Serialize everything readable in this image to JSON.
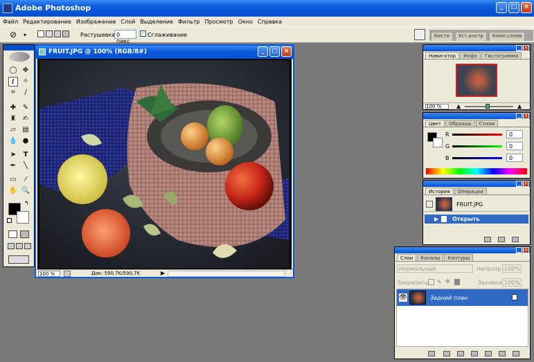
{
  "window": {
    "title": "Adobe Photoshop"
  },
  "menu": [
    "Файл",
    "Редактирование",
    "Изображение",
    "Слой",
    "Выделение",
    "Фильтр",
    "Просмотр",
    "Окно",
    "Справка"
  ],
  "options": {
    "feather_label": "Растушевка:",
    "feather_value": "0 пикс",
    "antialias_label": "Сглаживание",
    "dock_tabs": [
      "Кисти",
      "Уст.инстр",
      "Комп.слоев"
    ]
  },
  "document": {
    "title": "FRUIT.JPG @ 100% (RGB/8#)",
    "zoom": "100 %",
    "doc_info": "Док: 590,7K/590,7K"
  },
  "navigator": {
    "tabs": [
      "Навигатор",
      "Инфо",
      "Гистограмма"
    ],
    "zoom": "100 %"
  },
  "color": {
    "tabs": [
      "Цвет",
      "Образцы",
      "Стили"
    ],
    "channels": [
      {
        "label": "R",
        "value": "0",
        "color": "#d01010"
      },
      {
        "label": "G",
        "value": "0",
        "color": "#10a010"
      },
      {
        "label": "B",
        "value": "0",
        "color": "#1010d0"
      }
    ]
  },
  "history": {
    "tabs": [
      "История",
      "Операции"
    ],
    "snapshot": "FRUIT.JPG",
    "step": "Открыть"
  },
  "layers": {
    "tabs": [
      "Слои",
      "Каналы",
      "Контуры"
    ],
    "blend_mode": "Нормальный",
    "opacity_label": "Непрозр.:",
    "opacity": "100%",
    "lock_label": "Закрепить:",
    "fill_label": "Заливка:",
    "fill": "100%",
    "layer_name": "Задний план"
  },
  "colors": {
    "xp_blue": "#0a5adc",
    "highlight": "#316ac5",
    "panel_bg": "#ece9d8",
    "workspace": "#7a7a7a"
  }
}
